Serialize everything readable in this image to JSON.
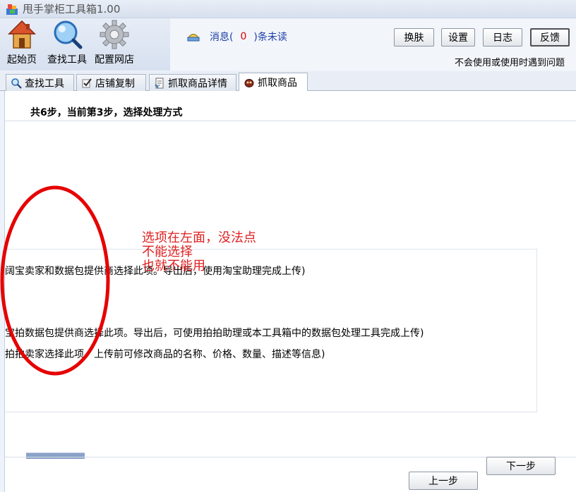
{
  "window": {
    "title": "甩手掌柜工具箱1.00"
  },
  "toolbar": {
    "home_label": "起始页",
    "find_label": "查找工具",
    "config_label": "配置网店"
  },
  "messages": {
    "prefix": "消息(",
    "count": "0",
    "suffix": ")条未读"
  },
  "buttons": {
    "skin": "换肤",
    "settings": "设置",
    "log": "日志",
    "feedback": "反馈"
  },
  "notice": "不会使用或使用时遇到问题",
  "tabs": [
    {
      "label": "查找工具",
      "icon": "magnifier-icon"
    },
    {
      "label": "店铺复制",
      "icon": "check-icon"
    },
    {
      "label": "抓取商品详情",
      "icon": "document-icon"
    },
    {
      "label": "抓取商品",
      "icon": "bug-icon",
      "active": true
    }
  ],
  "step_title": "共6步，当前第3步，选择处理方式",
  "options": [
    "阔宝卖家和数据包提供商选择此项。导出后，使用淘宝助理完成上传)",
    "宝拍数据包提供商选择此项。导出后，可使用拍拍助理或本工具箱中的数据包处理工具完成上传)",
    "拍拍卖家选择此项。上传前可修改商品的名称、价格、数量、描述等信息)"
  ],
  "faint_text": "▆▆▆▆▆▆▆▆▆",
  "nav": {
    "next": "下一步",
    "prev": "上一步"
  },
  "annotation": {
    "line1": "选项在左面，没法点",
    "line2": "不能选择",
    "line3": "也就不能用"
  },
  "colors": {
    "annotation": "#e02020",
    "message_count": "#e00000",
    "message_text": "#1c3fa8"
  }
}
